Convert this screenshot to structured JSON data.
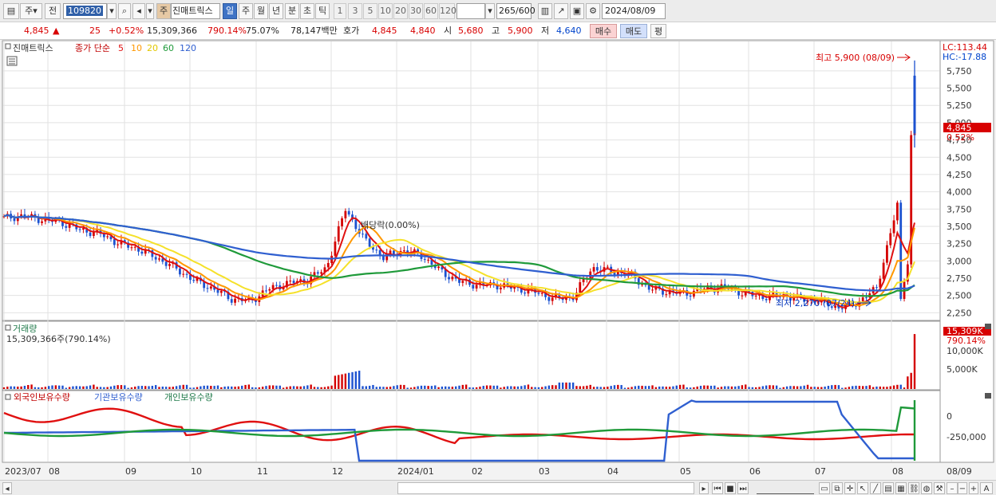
{
  "toolbar": {
    "market_type": "주",
    "market_scope": "전",
    "stock_code": "109820",
    "stock_name_tag": "주",
    "stock_name": "진매트릭스",
    "periods": [
      "일",
      "주",
      "월",
      "년",
      "분",
      "초",
      "틱"
    ],
    "active_period": "일",
    "intervals": [
      "1",
      "3",
      "5",
      "10",
      "20",
      "30",
      "60",
      "120"
    ],
    "count": "265",
    "count_max": "/600",
    "date": "2024/08/09"
  },
  "quote": {
    "price": "4,845",
    "change_arrow": "▲",
    "change": "25",
    "change_pct": "+0.52%",
    "volume": "15,309,366",
    "volume_ratio": "790.14%",
    "turnover_ratio": "75.07%",
    "trade_value": "78,147백만",
    "ask_label": "호가",
    "ask": "4,845",
    "bid": "4,840",
    "open_label": "시",
    "open": "5,680",
    "high_label": "고",
    "high": "5,900",
    "low_label": "저",
    "low": "4,640",
    "buy_label": "매수",
    "sell_label": "매도",
    "avg_label": "평"
  },
  "price_pane": {
    "legend_name": "진매트릭스",
    "legend_ma": "종가 단순",
    "ma_periods": [
      "5",
      "10",
      "20",
      "60",
      "120"
    ],
    "ma_colors": [
      "#e01010",
      "#ff9800",
      "#f5e12a",
      "#1f9a3a",
      "#2f5fd0"
    ],
    "lc_label": "LC:113.44",
    "hc_label": "HC:-17.88",
    "y_ticks": [
      "5,750",
      "5,500",
      "5,250",
      "5,000",
      "4,750",
      "4,500",
      "4,250",
      "4,000",
      "3,750",
      "3,500",
      "3,250",
      "3,000",
      "2,750",
      "2,500",
      "2,250"
    ],
    "current_price_tag": "4,845",
    "current_pct_tag": "0.52%",
    "high_annotation": "최고 5,900 (08/09)",
    "low_annotation": "최저 2,270 (07/24)",
    "dividend_annotation": "배당락(0.00%)"
  },
  "volume_pane": {
    "title": "거래량",
    "value": "15,309,366주(790.14%)",
    "y_ticks": [
      "10,000K",
      "5,000K"
    ],
    "current_tag": "15,309K",
    "current_pct": "790.14%"
  },
  "flow_pane": {
    "series_labels": [
      "외국인보유수량",
      "기관보유수량",
      "개인보유수량"
    ],
    "series_colors": [
      "#e01010",
      "#2f5fd0",
      "#1f9a3a"
    ],
    "y_ticks": [
      "0",
      "-250,000"
    ]
  },
  "x_axis": {
    "labels": [
      "2023/07",
      "08",
      "09",
      "10",
      "11",
      "12",
      "2024/01",
      "02",
      "03",
      "04",
      "05",
      "06",
      "07",
      "08"
    ],
    "end_label": "08/09"
  },
  "chart_data": {
    "type": "candlestick",
    "title": "진매트릭스 (109820) 일봉",
    "ylim": [
      2150,
      5900
    ],
    "price_scale": "KRW",
    "months": [
      "2023/07",
      "08",
      "09",
      "10",
      "11",
      "12",
      "2024/01",
      "02",
      "03",
      "04",
      "05",
      "06",
      "07",
      "08"
    ],
    "close_trend": [
      3620,
      3650,
      3600,
      3560,
      3450,
      3400,
      3260,
      3180,
      3050,
      2900,
      2720,
      2600,
      2450,
      2420,
      2600,
      2680,
      2720,
      2900,
      3750,
      3300,
      3050,
      3150,
      3080,
      2850,
      2700,
      2650,
      2650,
      2600,
      2550,
      2450,
      2480,
      2900,
      2850,
      2800,
      2600,
      2550,
      2530,
      2600,
      2620,
      2530,
      2480,
      2500,
      2450,
      2420,
      2320,
      2400,
      2600,
      3700,
      4845
    ],
    "extrema": {
      "high": 5900,
      "high_date": "08/09",
      "low": 2270,
      "low_date": "07/24"
    },
    "volume_current_k": 15309
  }
}
